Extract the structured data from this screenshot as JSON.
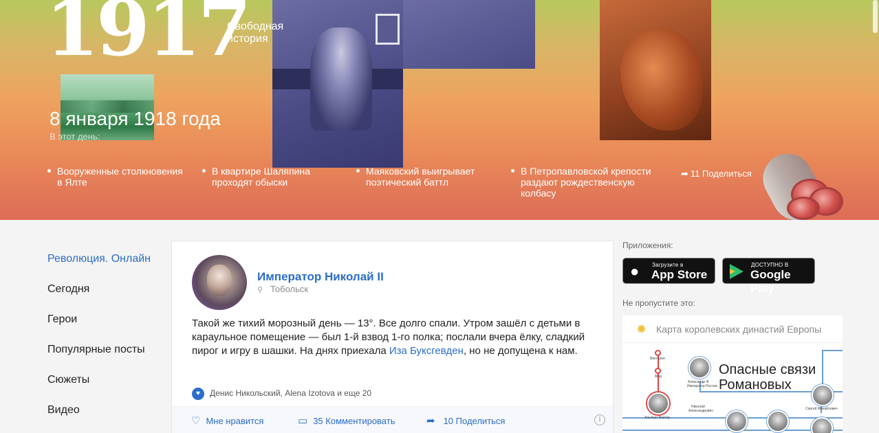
{
  "hero": {
    "logo_number": "1917",
    "logo_subtitle_line1": "Свободная",
    "logo_subtitle_line2": "история",
    "date": "8 января 1918 года",
    "subtitle": "В этот день:",
    "items": [
      {
        "line1": "Вооруженные столкновения",
        "line2": "в Ялте"
      },
      {
        "line1": "В квартире Шаляпина",
        "line2": "проходят обыски"
      },
      {
        "line1": "Маяковский выигрывает",
        "line2": "поэтический баттл"
      },
      {
        "line1": "В Петропавловской крепости",
        "line2": "раздают рождественскую",
        "line3": "колбасу"
      }
    ],
    "share_count": "11",
    "share_label": "Поделиться",
    "share_icon": "share-arrow-icon"
  },
  "nav": {
    "items": [
      {
        "label": "Революция. Онлайн",
        "active": true
      },
      {
        "label": "Сегодня"
      },
      {
        "label": "Герои"
      },
      {
        "label": "Популярные посты"
      },
      {
        "label": "Сюжеты"
      },
      {
        "label": "Видео"
      }
    ]
  },
  "post": {
    "author": "Император Николай II",
    "location": "Тобольск",
    "text_before_link": "Такой же тихий морозный день — 13°. Все долго спали. Утром зашёл с детьми в караульное помещение — был 1-й взвод 1-го полка; послали вчера ёлку, сладкий пирог и игру в шашки. На днях приехала ",
    "link_text": "Иза Буксгевден",
    "text_after_link": ", но не допущена к нам.",
    "likes_summary": "Денис Никольский, Alena Izotova и еще 20",
    "actions": {
      "like_label": "Мне нравится",
      "comment_count": "35",
      "comment_label": "Комментировать",
      "share_count": "10",
      "share_label": "Поделиться"
    }
  },
  "sidebar": {
    "apps_label": "Приложения:",
    "appstore_small": "Загрузите в",
    "appstore_big": "App Store",
    "googleplay_small": "ДОСТУПНО В",
    "googleplay_big": "Google Play",
    "dont_miss_label": "Не пропустите это:",
    "promo_title": "Карта королевских династий Европы",
    "promo_heading_line1": "Опасные связи",
    "promo_heading_line2": "Романовых",
    "tree_labels": {
      "viktoriya": "Виктория",
      "mod": "Мод",
      "albert_viktor": "Альберт Виктор",
      "aleksandr_iii": "Александр III",
      "aleksandr_iii_sub": "Император России",
      "nikolay": "Николай",
      "nikolay_sub": "Александрович",
      "sergey": "Сергей Михайлович"
    }
  },
  "colors": {
    "accent": "#2b6dc8",
    "hero_top": "#b8c85e",
    "hero_bottom": "#dd6c57"
  }
}
